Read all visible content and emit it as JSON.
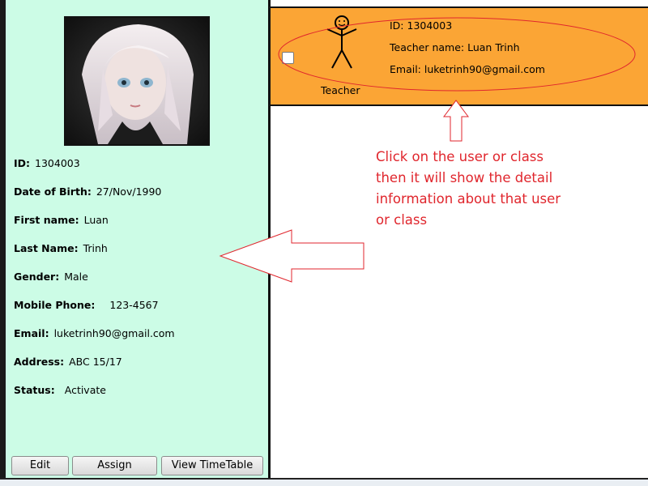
{
  "profile": {
    "photo_alt": "user-photo",
    "fields": [
      {
        "key": "ID:",
        "value": "1304003"
      },
      {
        "key": "Date of Birth:",
        "value": "27/Nov/1990"
      },
      {
        "key": "First name:",
        "value": "Luan"
      },
      {
        "key": "Last Name:",
        "value": "Trinh"
      },
      {
        "key": "Gender:",
        "value": "Male"
      },
      {
        "key": "Mobile Phone:",
        "value": "123-4567"
      },
      {
        "key": "Email:",
        "value": "luketrinh90@gmail.com"
      },
      {
        "key": "Address:",
        "value": "ABC 15/17"
      },
      {
        "key": "Status:",
        "value": "Activate"
      }
    ]
  },
  "buttons": {
    "edit": "Edit",
    "assign": "Assign",
    "timetable": "View TimeTable"
  },
  "user_card": {
    "id_line": "ID: 1304003",
    "name_line": "Teacher name: Luan Trinh",
    "email_line": "Email: luketrinh90@gmail.com",
    "role_label": "Teacher"
  },
  "annotation": {
    "text": "Click on the user or class then it will show the detail information about that user or class",
    "color": "#e0262d"
  },
  "colors": {
    "left_panel": "#ccfce6",
    "card": "#fba535"
  }
}
